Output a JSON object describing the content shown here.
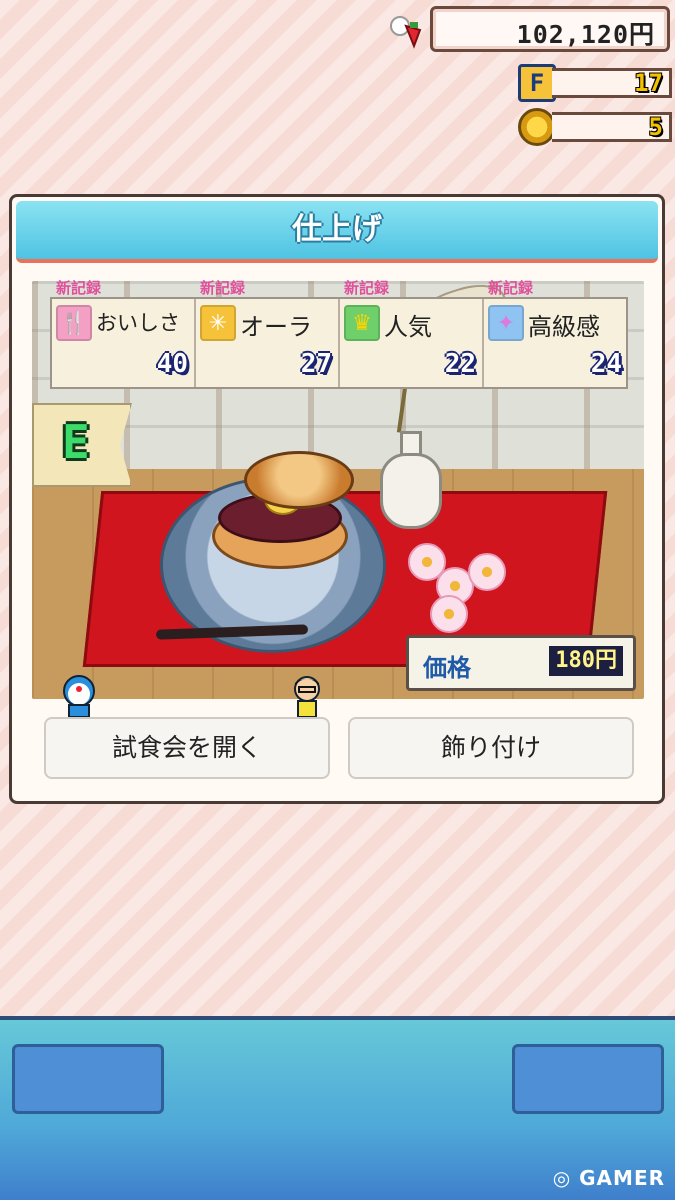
{
  "hud": {
    "money": "102,120円",
    "f_points": "17",
    "coins": "5"
  },
  "panel": {
    "title": "仕上げ",
    "stats": [
      {
        "record": "新記録",
        "label": "おいしさ",
        "value": "40",
        "icon": "fork-spoon-icon",
        "icon_color": "#f3a0c4"
      },
      {
        "record": "新記録",
        "label": "オーラ",
        "value": "27",
        "icon": "sparkle-icon",
        "icon_color": "#f6c23a"
      },
      {
        "record": "新記録",
        "label": "人気",
        "value": "22",
        "icon": "crown-icon",
        "icon_color": "#6fd06b"
      },
      {
        "record": "新記録",
        "label": "高級感",
        "value": "24",
        "icon": "stars-icon",
        "icon_color": "#8fc3f2"
      }
    ],
    "rank": "E",
    "price_label": "価格",
    "price_value": "180円",
    "buttons": {
      "tasting": "試食会を開く",
      "decorate": "飾り付け"
    }
  },
  "watermark": "GAMER",
  "colors": {
    "header": "#4ec3e2",
    "record_pink": "#e0519c",
    "value_navy": "#1b2470",
    "mat_red": "#d0151f"
  }
}
